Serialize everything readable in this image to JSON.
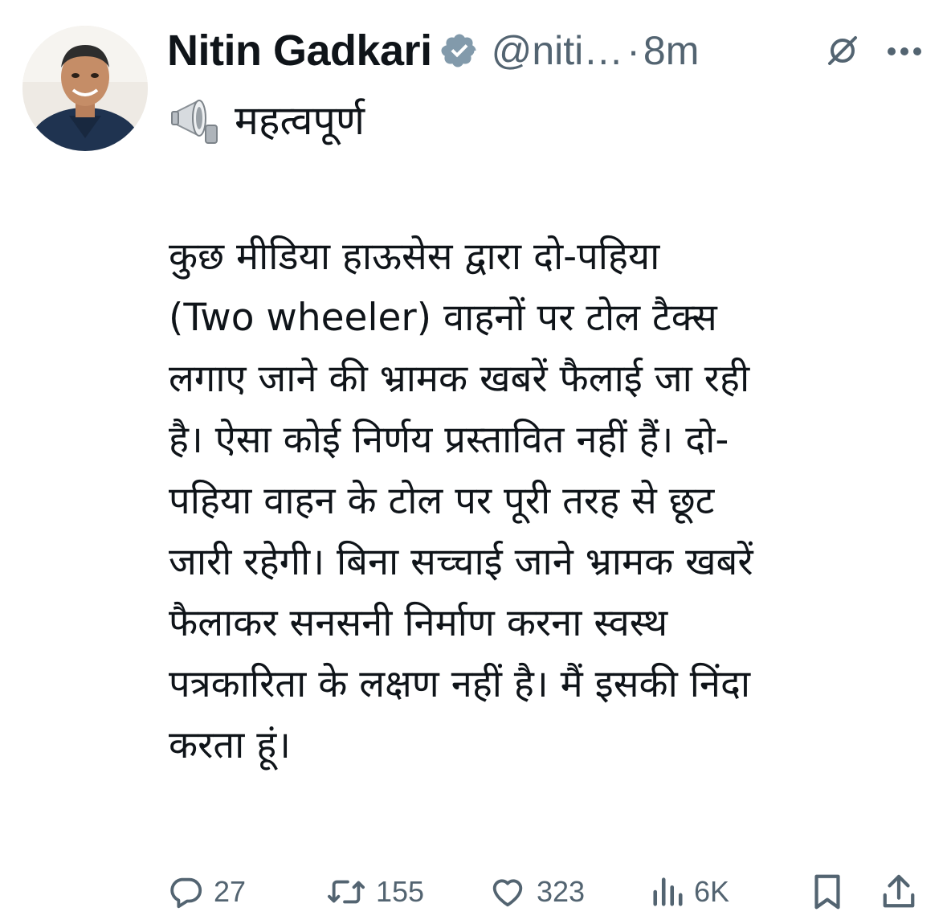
{
  "tweet": {
    "author_name": "Nitin Gadkari",
    "handle": "@niti…",
    "separator": "·",
    "time": "8m",
    "label_emoji": "megaphone",
    "label": "महत्वपूर्ण",
    "body_lines": [
      "कुछ मीडिया हाऊसेस  द्वारा दो-पहिया",
      "(Two wheeler) वाहनों पर टोल टैक्स",
      "लगाए जाने की भ्रामक खबरें फैलाई जा रही",
      "है। ऐसा कोई निर्णय प्रस्तावित नहीं हैं। दो-",
      "पहिया वाहन के टोल पर पूरी तरह से छूट",
      "जारी रहेगी। बिना सच्चाई जाने भ्रामक खबरें",
      "फैलाकर सनसनी निर्माण करना स्वस्थ",
      "पत्रकारिता के लक्षण नहीं है। मैं इसकी निंदा",
      "करता हूं।"
    ]
  },
  "actions": {
    "replies": "27",
    "reposts": "155",
    "likes": "323",
    "views": "6K"
  },
  "icons": {
    "verified": "verified-badge-icon",
    "grok": "grok-icon",
    "more": "more-icon",
    "reply": "reply-icon",
    "repost": "repost-icon",
    "like": "heart-icon",
    "views": "views-icon",
    "bookmark": "bookmark-icon",
    "share": "share-icon"
  },
  "colors": {
    "text": "#0f1419",
    "secondary": "#536471",
    "verified_badge": "#829aab",
    "background": "#ffffff"
  }
}
